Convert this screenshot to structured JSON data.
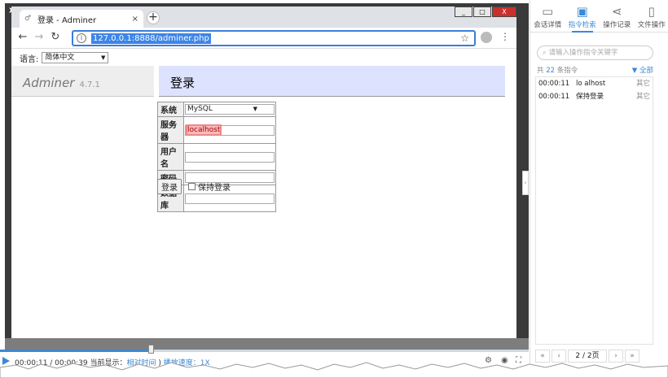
{
  "browser": {
    "tab_title": "登录 - Adminer",
    "tab_close": "×",
    "new_tab": "+",
    "url": "127.0.0.1:8888/adminer.php",
    "win_min": "_",
    "win_max": "□",
    "win_close": "X"
  },
  "page": {
    "lang_label": "语言:",
    "lang_value": "简体中文",
    "logo": "Adminer",
    "version": "4.7.1",
    "heading": "登录",
    "fields": [
      {
        "label": "系统",
        "value": "MySQL"
      },
      {
        "label": "服务器",
        "value": "localhost"
      },
      {
        "label": "用户名",
        "value": ""
      },
      {
        "label": "密码",
        "value": ""
      },
      {
        "label": "数据库",
        "value": ""
      }
    ],
    "login_button": "登录",
    "remember_label": "保持登录"
  },
  "player": {
    "time": "00:00:11 / 00:00:39",
    "current_display": "当前显示：",
    "relative_time": "相对时间",
    "speed_label": "播放速度：",
    "speed_value": "1X",
    "progress": 0.28
  },
  "panel": {
    "tabs": [
      {
        "label": "会话详情",
        "icon": "video-icon"
      },
      {
        "label": "指令检索",
        "icon": "terminal-icon"
      },
      {
        "label": "操作记录",
        "icon": "share-icon"
      },
      {
        "label": "文件操作",
        "icon": "file-icon"
      }
    ],
    "search_placeholder": "请输入操作指令关键字",
    "count_prefix": "共",
    "count": "22",
    "count_suffix": "条指令",
    "filter_all": "全部",
    "rows": [
      {
        "time": "00:00:11",
        "cmd": "lo alhost",
        "kind": "其它"
      },
      {
        "time": "00:00:11",
        "cmd": "保持登录",
        "kind": "其它"
      }
    ],
    "page": "2 / 2页",
    "pager_first": "«",
    "pager_prev": "‹",
    "pager_next": "›",
    "pager_last": "»"
  }
}
